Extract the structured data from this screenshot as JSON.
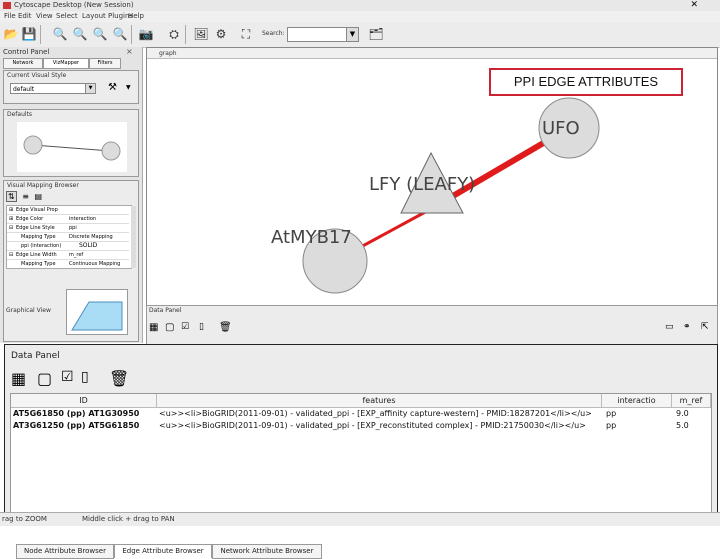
{
  "window": {
    "title": "Cytoscape Desktop (New Session)",
    "close_glyph": "✕"
  },
  "menu": [
    "File",
    "Edit",
    "View",
    "Select",
    "Layout",
    "Plugins",
    "Help"
  ],
  "toolbar": {
    "search_label": "Search:",
    "search_value": ""
  },
  "control_panel": {
    "title": "Control Panel",
    "tabs": [
      "Network",
      "VizMapper",
      "Filters"
    ],
    "visual_style_label": "Current Visual Style",
    "visual_style_value": "default",
    "defaults_label": "Defaults",
    "mapping_browser_label": "Visual Mapping Browser",
    "mapping_rows": [
      {
        "prop": "Edge Visual Prop",
        "val": ""
      },
      {
        "prop": "Edge Color",
        "val": "interaction"
      },
      {
        "prop": "Edge Line Style",
        "val": "ppi"
      },
      {
        "prop": "Mapping Type",
        "val": "Discrete Mapping"
      },
      {
        "prop": "ppi (interaction)",
        "val": "SOLID"
      },
      {
        "prop": "Edge Line Width",
        "val": "m_ref"
      },
      {
        "prop": "Mapping Type",
        "val": "Continuous Mapping"
      }
    ],
    "graphical_view_label": "Graphical View"
  },
  "graph": {
    "tab_label": "graph",
    "callout": "PPI EDGE ATTRIBUTES",
    "nodes": [
      {
        "id": "UFO",
        "label": "UFO"
      },
      {
        "id": "LFY",
        "label": "LFY (LEAFY)"
      },
      {
        "id": "AtMYB17",
        "label": "AtMYB17"
      }
    ]
  },
  "data_pane_small": {
    "label": "Data Panel"
  },
  "data_panel": {
    "title": "Data Panel",
    "columns": [
      "ID",
      "features",
      "interactio",
      "m_ref"
    ],
    "rows": [
      {
        "id": "AT5G61850 (pp) AT1G30950",
        "features": "<u>><li>BioGRID(2011-09-01) - validated_ppi - [EXP_affinity capture-western] - PMID:18287201</li></u>",
        "interaction": "pp",
        "m_ref": "9.0"
      },
      {
        "id": "AT3G61250 (pp) AT5G61850",
        "features": "<u>><li>BioGRID(2011-09-01) - validated_ppi - [EXP_reconstituted complex] - PMID:21750030</li></u>",
        "interaction": "pp",
        "m_ref": "5.0"
      }
    ],
    "bottom_tabs": [
      "Node Attribute Browser",
      "Edge Attribute Browser",
      "Network Attribute Browser"
    ]
  },
  "status": {
    "left": "rag to ZOOM",
    "middle": "Middle click + drag to PAN"
  },
  "colors": {
    "edge_red": "#e01b1b",
    "node_fill": "#dcdcdc",
    "callout_border": "#c22233"
  }
}
